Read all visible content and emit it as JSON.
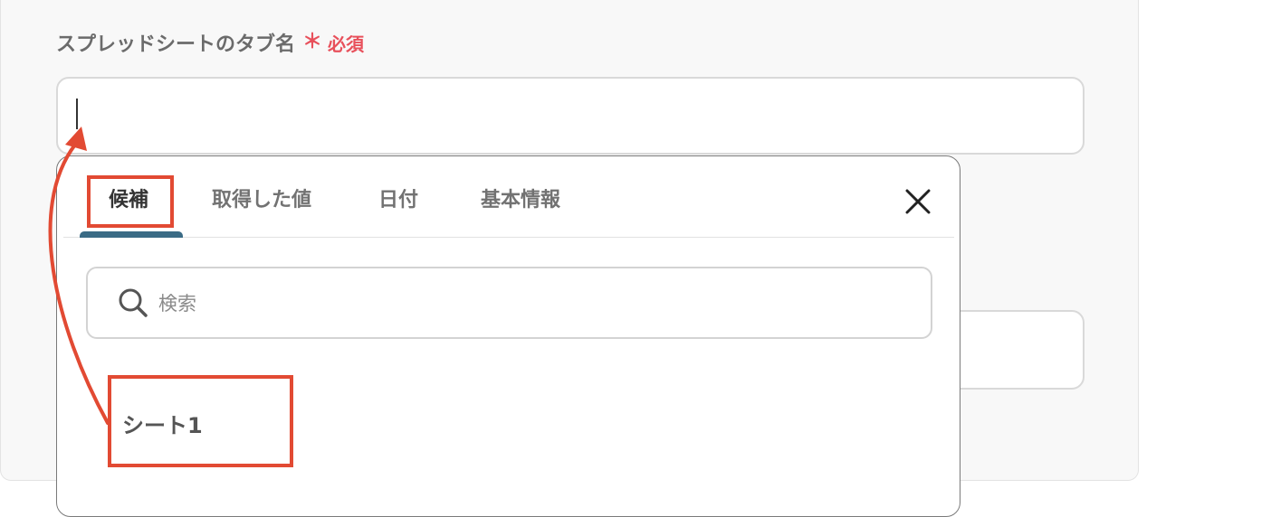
{
  "field": {
    "label": "スプレッドシートのタブ名",
    "required_mark": "＊",
    "required_text": "必須",
    "value": ""
  },
  "popup": {
    "tabs": [
      {
        "label": "候補",
        "active": true
      },
      {
        "label": "取得した値",
        "active": false
      },
      {
        "label": "日付",
        "active": false
      },
      {
        "label": "基本情報",
        "active": false
      }
    ],
    "search_placeholder": "検索",
    "options": [
      "シート1"
    ]
  },
  "colors": {
    "required": "#e8505b",
    "tab_underline": "#3a6b85",
    "annotation": "#e24a33"
  },
  "icons": {
    "close": "close-icon",
    "search": "search-icon"
  }
}
